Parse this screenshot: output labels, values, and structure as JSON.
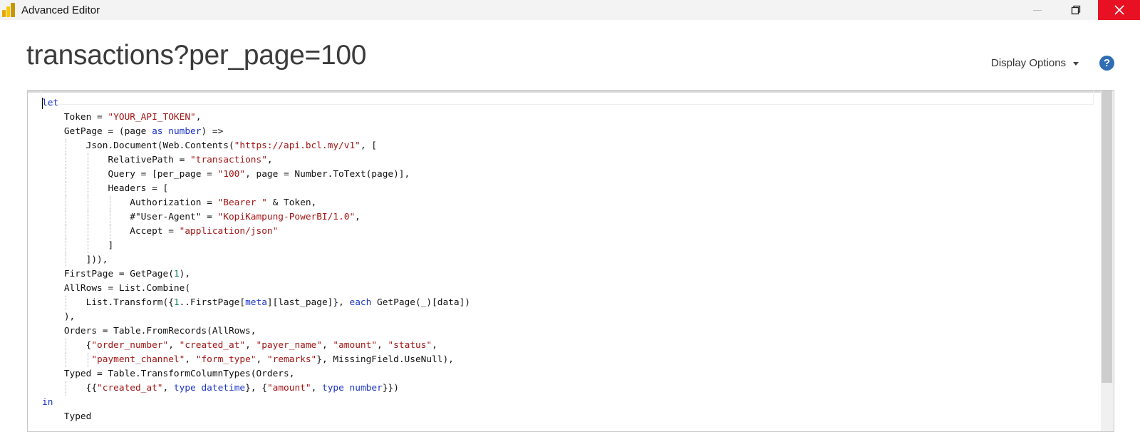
{
  "window": {
    "title": "Advanced Editor"
  },
  "query": {
    "title": "transactions?per_page=100"
  },
  "toolbar": {
    "display_options_label": "Display Options",
    "help_glyph": "?"
  },
  "icons": [
    "powerbi-logo-icon",
    "minimize-icon",
    "restore-icon",
    "close-icon",
    "chevron-down-icon",
    "help-icon"
  ],
  "colors": {
    "keyword": "#1d36c8",
    "string": "#a31515",
    "number": "#09885a",
    "close_button": "#e81123",
    "help": "#2f6eb5"
  },
  "code_lines": [
    [
      {
        "t": "let",
        "c": "kw"
      }
    ],
    [
      {
        "t": "    Token = ",
        "c": "plain"
      },
      {
        "t": "\"YOUR_API_TOKEN\"",
        "c": "str"
      },
      {
        "t": ",",
        "c": "plain"
      }
    ],
    [
      {
        "t": "    GetPage = (page ",
        "c": "plain"
      },
      {
        "t": "as",
        "c": "kw"
      },
      {
        "t": " ",
        "c": "plain"
      },
      {
        "t": "number",
        "c": "kw"
      },
      {
        "t": ") =>",
        "c": "plain"
      }
    ],
    [
      {
        "t": "        Json.Document(Web.Contents(",
        "c": "plain"
      },
      {
        "t": "\"https://api.bcl.my/v1\"",
        "c": "str"
      },
      {
        "t": ", [",
        "c": "plain"
      }
    ],
    [
      {
        "t": "            RelativePath = ",
        "c": "plain"
      },
      {
        "t": "\"transactions\"",
        "c": "str"
      },
      {
        "t": ",",
        "c": "plain"
      }
    ],
    [
      {
        "t": "            Query = [per_page = ",
        "c": "plain"
      },
      {
        "t": "\"100\"",
        "c": "str"
      },
      {
        "t": ", page = Number.ToText(page)],",
        "c": "plain"
      }
    ],
    [
      {
        "t": "            Headers = [",
        "c": "plain"
      }
    ],
    [
      {
        "t": "                Authorization = ",
        "c": "plain"
      },
      {
        "t": "\"Bearer \"",
        "c": "str"
      },
      {
        "t": " & Token,",
        "c": "plain"
      }
    ],
    [
      {
        "t": "                #\"User-Agent\" = ",
        "c": "plain"
      },
      {
        "t": "\"KopiKampung-PowerBI/1.0\"",
        "c": "str"
      },
      {
        "t": ",",
        "c": "plain"
      }
    ],
    [
      {
        "t": "                Accept = ",
        "c": "plain"
      },
      {
        "t": "\"application/json\"",
        "c": "str"
      }
    ],
    [
      {
        "t": "            ]",
        "c": "plain"
      }
    ],
    [
      {
        "t": "        ])),",
        "c": "plain"
      }
    ],
    [
      {
        "t": "    FirstPage = GetPage(",
        "c": "plain"
      },
      {
        "t": "1",
        "c": "num"
      },
      {
        "t": "),",
        "c": "plain"
      }
    ],
    [
      {
        "t": "    AllRows = List.Combine(",
        "c": "plain"
      }
    ],
    [
      {
        "t": "        List.Transform({",
        "c": "plain"
      },
      {
        "t": "1",
        "c": "num"
      },
      {
        "t": "..FirstPage[",
        "c": "plain"
      },
      {
        "t": "meta",
        "c": "kw"
      },
      {
        "t": "][last_page]}, ",
        "c": "plain"
      },
      {
        "t": "each",
        "c": "kw"
      },
      {
        "t": " GetPage(_)[data])",
        "c": "plain"
      }
    ],
    [
      {
        "t": "    ),",
        "c": "plain"
      }
    ],
    [
      {
        "t": "    Orders = Table.FromRecords(AllRows,",
        "c": "plain"
      }
    ],
    [
      {
        "t": "        {",
        "c": "plain"
      },
      {
        "t": "\"order_number\"",
        "c": "str"
      },
      {
        "t": ", ",
        "c": "plain"
      },
      {
        "t": "\"created_at\"",
        "c": "str"
      },
      {
        "t": ", ",
        "c": "plain"
      },
      {
        "t": "\"payer_name\"",
        "c": "str"
      },
      {
        "t": ", ",
        "c": "plain"
      },
      {
        "t": "\"amount\"",
        "c": "str"
      },
      {
        "t": ", ",
        "c": "plain"
      },
      {
        "t": "\"status\"",
        "c": "str"
      },
      {
        "t": ",",
        "c": "plain"
      }
    ],
    [
      {
        "t": "         ",
        "c": "plain"
      },
      {
        "t": "\"payment_channel\"",
        "c": "str"
      },
      {
        "t": ", ",
        "c": "plain"
      },
      {
        "t": "\"form_type\"",
        "c": "str"
      },
      {
        "t": ", ",
        "c": "plain"
      },
      {
        "t": "\"remarks\"",
        "c": "str"
      },
      {
        "t": "}, MissingField.UseNull),",
        "c": "plain"
      }
    ],
    [
      {
        "t": "    Typed = Table.TransformColumnTypes(Orders,",
        "c": "plain"
      }
    ],
    [
      {
        "t": "        {{",
        "c": "plain"
      },
      {
        "t": "\"created_at\"",
        "c": "str"
      },
      {
        "t": ", ",
        "c": "plain"
      },
      {
        "t": "type",
        "c": "kw"
      },
      {
        "t": " ",
        "c": "plain"
      },
      {
        "t": "datetime",
        "c": "kw"
      },
      {
        "t": "}, {",
        "c": "plain"
      },
      {
        "t": "\"amount\"",
        "c": "str"
      },
      {
        "t": ", ",
        "c": "plain"
      },
      {
        "t": "type",
        "c": "kw"
      },
      {
        "t": " ",
        "c": "plain"
      },
      {
        "t": "number",
        "c": "kw"
      },
      {
        "t": "}})",
        "c": "plain"
      }
    ],
    [
      {
        "t": "in",
        "c": "kw"
      }
    ],
    [
      {
        "t": "    Typed",
        "c": "plain"
      }
    ]
  ]
}
